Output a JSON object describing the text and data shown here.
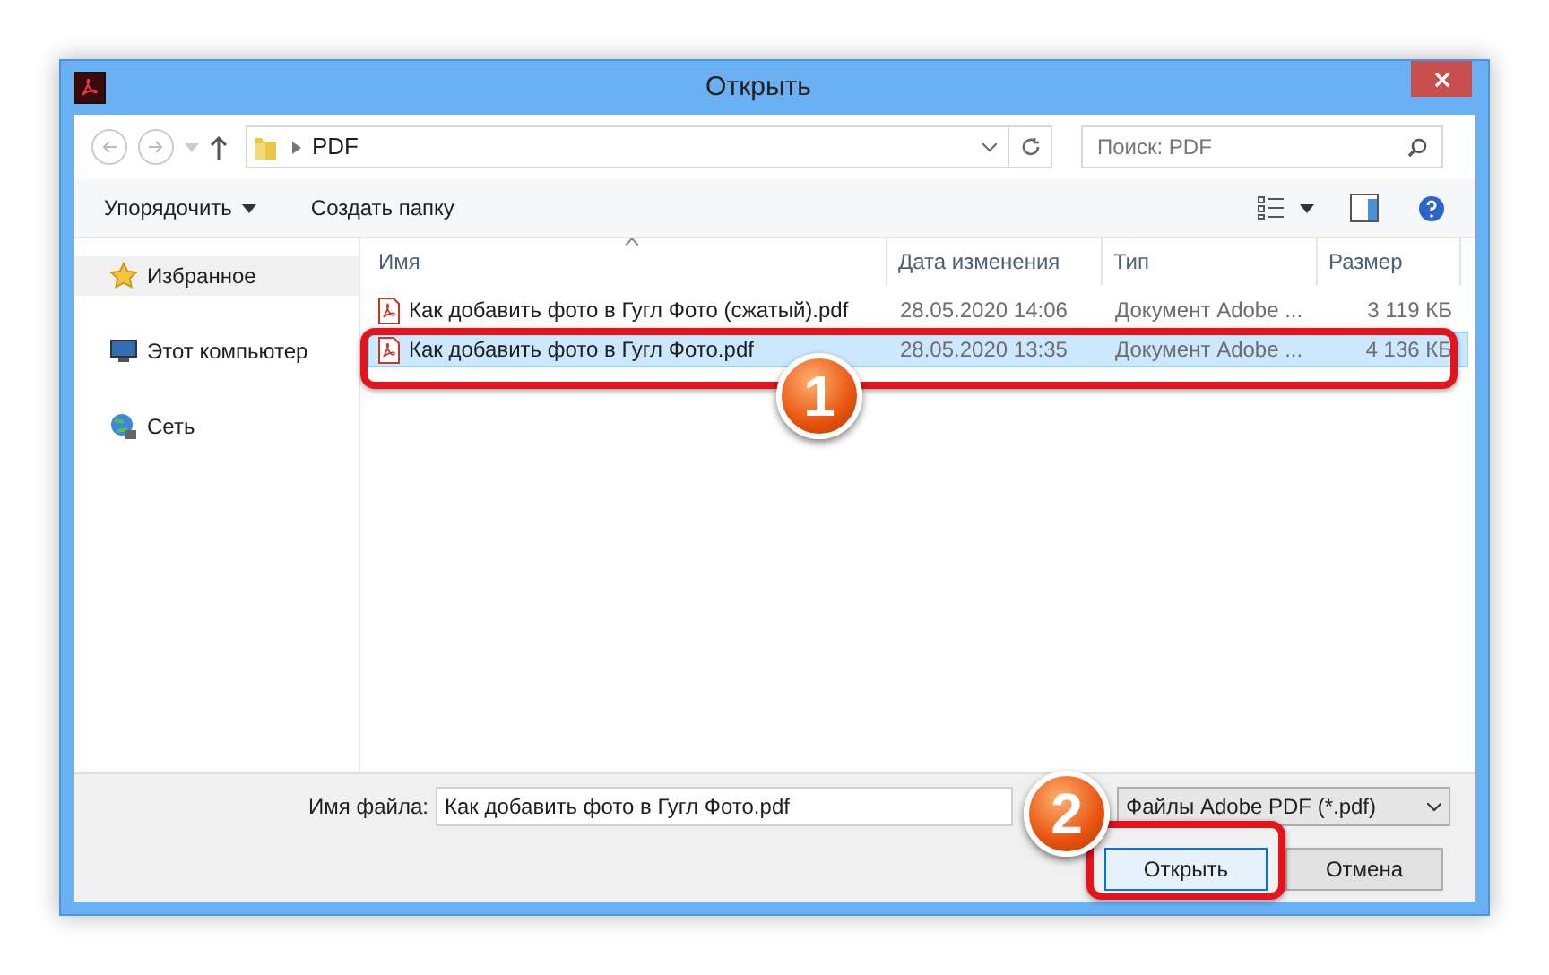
{
  "window": {
    "title": "Открыть"
  },
  "nav": {
    "path": "PDF",
    "search_placeholder": "Поиск: PDF"
  },
  "toolbar": {
    "organize": "Упорядочить",
    "new_folder": "Создать папку"
  },
  "sidebar": {
    "items": [
      {
        "label": "Избранное",
        "kind": "favorites",
        "selected": true
      },
      {
        "label": "Этот компьютер",
        "kind": "computer",
        "selected": false
      },
      {
        "label": "Сеть",
        "kind": "network",
        "selected": false
      }
    ]
  },
  "table": {
    "columns": [
      "Имя",
      "Дата изменения",
      "Тип",
      "Размер"
    ],
    "rows": [
      {
        "name": "Как добавить фото в Гугл Фото (сжатый).pdf",
        "date": "28.05.2020 14:06",
        "type": "Документ Adobe ...",
        "size": "3 119 КБ",
        "selected": false
      },
      {
        "name": "Как добавить фото в Гугл Фото.pdf",
        "date": "28.05.2020 13:35",
        "type": "Документ Adobe ...",
        "size": "4 136 КБ",
        "selected": true
      }
    ]
  },
  "footer": {
    "filename_label": "Имя файла:",
    "filename": "Как добавить фото в Гугл Фото.pdf",
    "filter": "Файлы Adobe PDF (*.pdf)",
    "open": "Открыть",
    "cancel": "Отмена"
  },
  "annotations": [
    "1",
    "2"
  ]
}
